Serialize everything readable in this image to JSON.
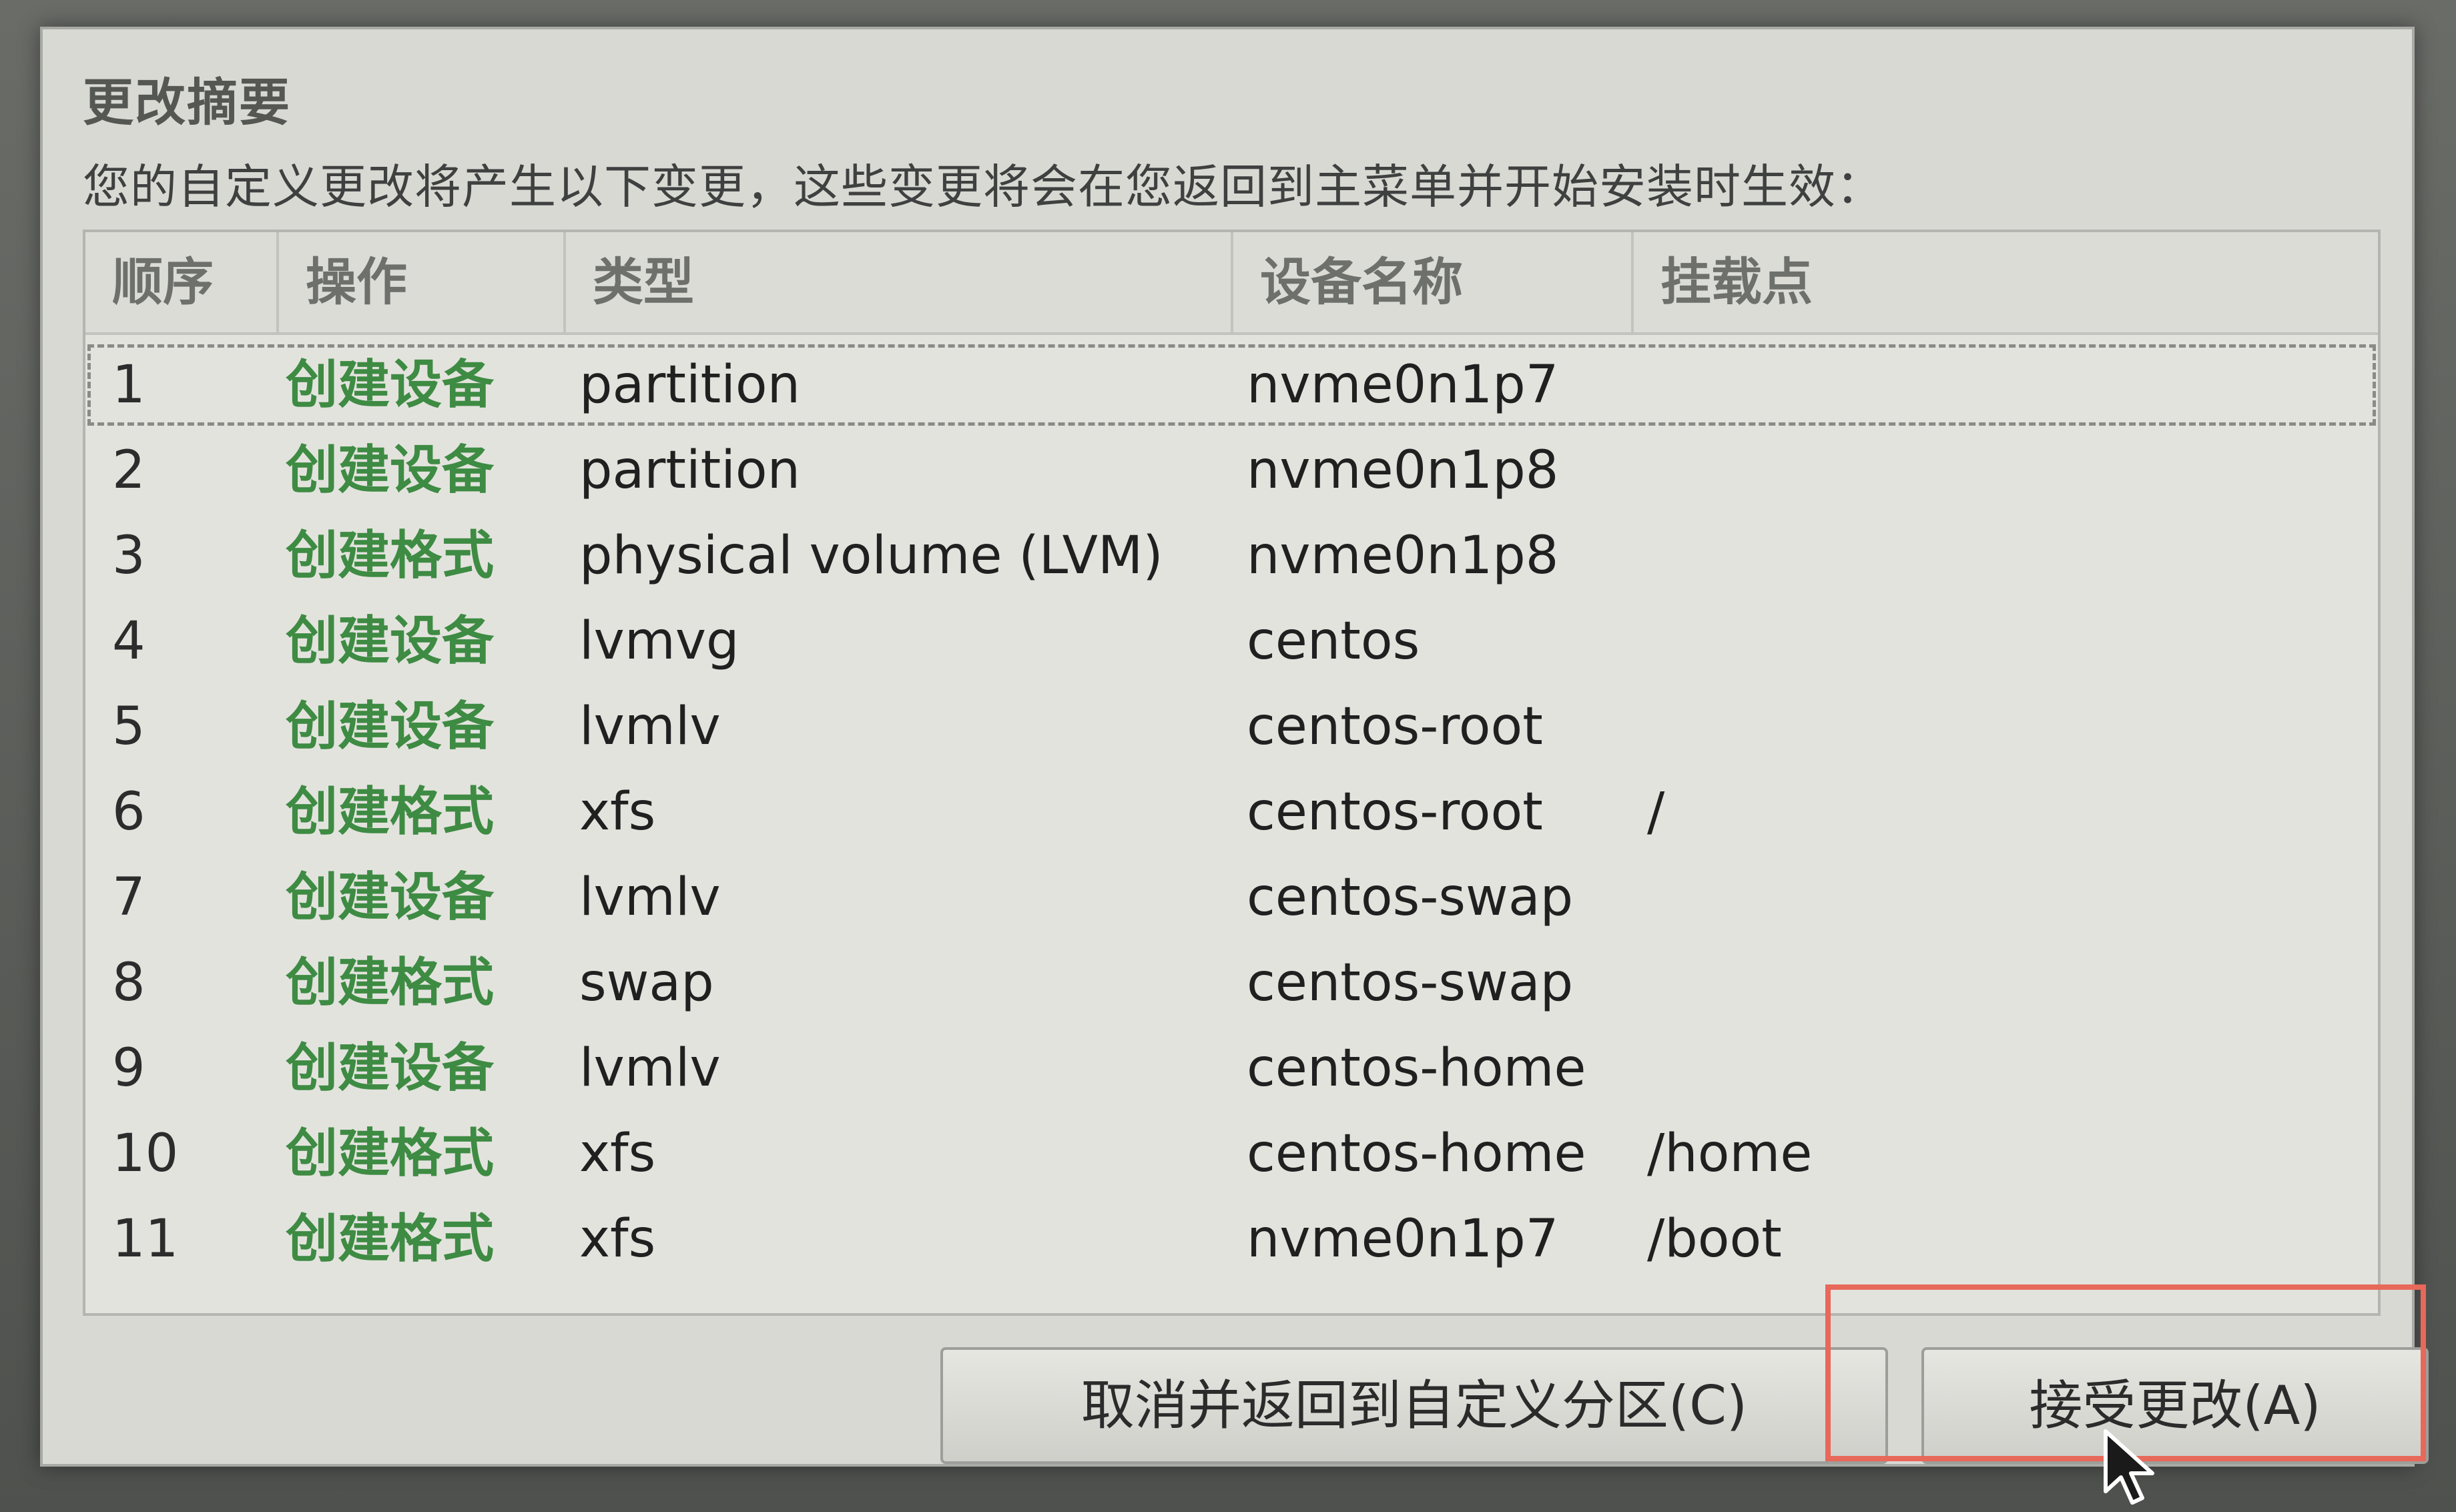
{
  "dialog": {
    "title": "更改摘要",
    "subtitle": "您的自定义更改将产生以下变更，这些变更将会在您返回到主菜单并开始安装时生效："
  },
  "table": {
    "columns": [
      "顺序",
      "操作",
      "类型",
      "设备名称",
      "挂载点"
    ],
    "rows": [
      {
        "order": "1",
        "action": "创建设备",
        "type": "partition",
        "device": "nvme0n1p7",
        "mount": ""
      },
      {
        "order": "2",
        "action": "创建设备",
        "type": "partition",
        "device": "nvme0n1p8",
        "mount": ""
      },
      {
        "order": "3",
        "action": "创建格式",
        "type": "physical volume (LVM)",
        "device": "nvme0n1p8",
        "mount": ""
      },
      {
        "order": "4",
        "action": "创建设备",
        "type": "lvmvg",
        "device": "centos",
        "mount": ""
      },
      {
        "order": "5",
        "action": "创建设备",
        "type": "lvmlv",
        "device": "centos-root",
        "mount": ""
      },
      {
        "order": "6",
        "action": "创建格式",
        "type": "xfs",
        "device": "centos-root",
        "mount": "/"
      },
      {
        "order": "7",
        "action": "创建设备",
        "type": "lvmlv",
        "device": "centos-swap",
        "mount": ""
      },
      {
        "order": "8",
        "action": "创建格式",
        "type": "swap",
        "device": "centos-swap",
        "mount": ""
      },
      {
        "order": "9",
        "action": "创建设备",
        "type": "lvmlv",
        "device": "centos-home",
        "mount": ""
      },
      {
        "order": "10",
        "action": "创建格式",
        "type": "xfs",
        "device": "centos-home",
        "mount": "/home"
      },
      {
        "order": "11",
        "action": "创建格式",
        "type": "xfs",
        "device": "nvme0n1p7",
        "mount": "/boot"
      }
    ]
  },
  "buttons": {
    "cancel_label": "取消并返回到自定义分区(C)",
    "accept_label": "接受更改(A)"
  },
  "colors": {
    "action_green": "#3e8b43",
    "highlight_red": "#e8685a"
  },
  "icons": {
    "cursor": "mouse-pointer-icon"
  }
}
